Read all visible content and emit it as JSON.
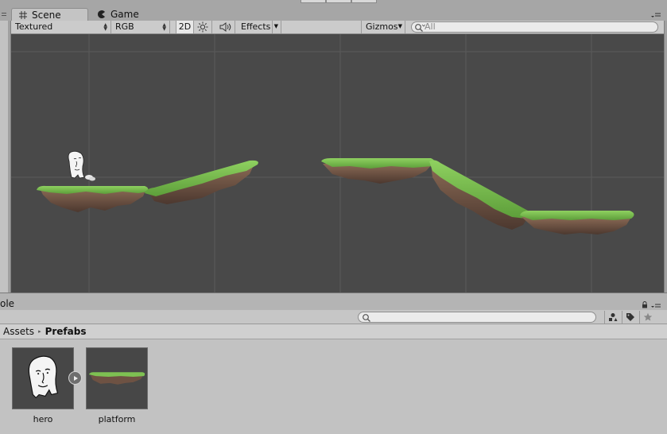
{
  "scene_tabs": {
    "scene_label": "Scene",
    "game_label": "Game"
  },
  "scene_toolbar": {
    "draw_mode": "Textured",
    "render_mode": "RGB",
    "mode_2d": "2D",
    "effects_label": "Effects",
    "gizmos_label": "Gizmos",
    "search_placeholder": "All"
  },
  "lower_panel": {
    "truncated_tab_label": "ole",
    "breadcrumb": {
      "root": "Assets",
      "separator": "▸",
      "current": "Prefabs"
    },
    "assets": [
      {
        "name": "hero"
      },
      {
        "name": "platform"
      }
    ]
  },
  "colors": {
    "viewport_bg": "#494949",
    "grid_line": "#5a5a5a",
    "grass": "#7ec152",
    "grass_dark": "#4f8a33",
    "dirt": "#6e5243",
    "dirt_dark": "#4e3a31"
  },
  "icons": [
    "scene-grid-icon",
    "game-pacman-icon",
    "lighting-sun-icon",
    "audio-speaker-icon",
    "search-icon",
    "lock-icon",
    "panel-menu-icon",
    "filter-by-type-icon",
    "filter-by-label-icon",
    "favorites-star-icon",
    "expand-play-icon"
  ]
}
